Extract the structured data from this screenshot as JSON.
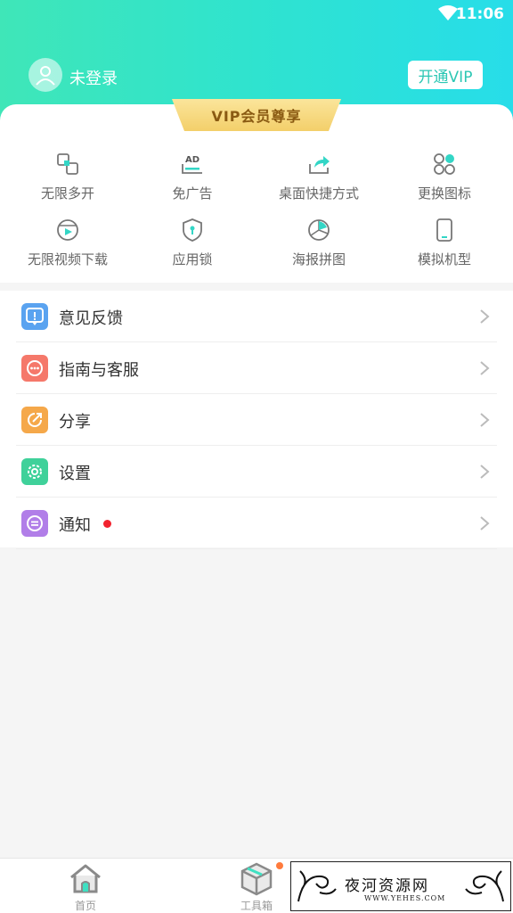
{
  "status_bar": {
    "time": "11:06"
  },
  "profile": {
    "login_text": "未登录",
    "vip_button": "开通VIP"
  },
  "vip_section": {
    "badge": "VIP会员尊享",
    "features": [
      {
        "label": "无限多开",
        "icon": "multi-open-icon"
      },
      {
        "label": "免广告",
        "icon": "no-ads-icon"
      },
      {
        "label": "桌面快捷方式",
        "icon": "shortcut-icon"
      },
      {
        "label": "更换图标",
        "icon": "change-icon-icon"
      },
      {
        "label": "无限视频下载",
        "icon": "video-download-icon"
      },
      {
        "label": "应用锁",
        "icon": "app-lock-icon"
      },
      {
        "label": "海报拼图",
        "icon": "poster-icon"
      },
      {
        "label": "模拟机型",
        "icon": "device-model-icon"
      }
    ]
  },
  "menu": [
    {
      "label": "意见反馈",
      "icon": "feedback-icon",
      "color": "#5aa3f0"
    },
    {
      "label": "指南与客服",
      "icon": "customer-service-icon",
      "color": "#f5786a"
    },
    {
      "label": "分享",
      "icon": "share-icon",
      "color": "#f5a84a"
    },
    {
      "label": "设置",
      "icon": "settings-icon",
      "color": "#3fd19a"
    },
    {
      "label": "通知",
      "icon": "notification-icon",
      "color": "#b17ee8",
      "badge": true
    }
  ],
  "tabbar": {
    "tabs": [
      {
        "label": "首页",
        "icon": "home-icon"
      },
      {
        "label": "工具箱",
        "icon": "toolbox-icon",
        "badge": true
      }
    ]
  },
  "watermark": {
    "text": "夜河资源网",
    "url": "WWW.YEHES.COM"
  },
  "colors": {
    "accent": "#2cc7b4",
    "header_start": "#3fe6b8",
    "header_end": "#27dde9",
    "vip_gold": "#f6d77c"
  }
}
